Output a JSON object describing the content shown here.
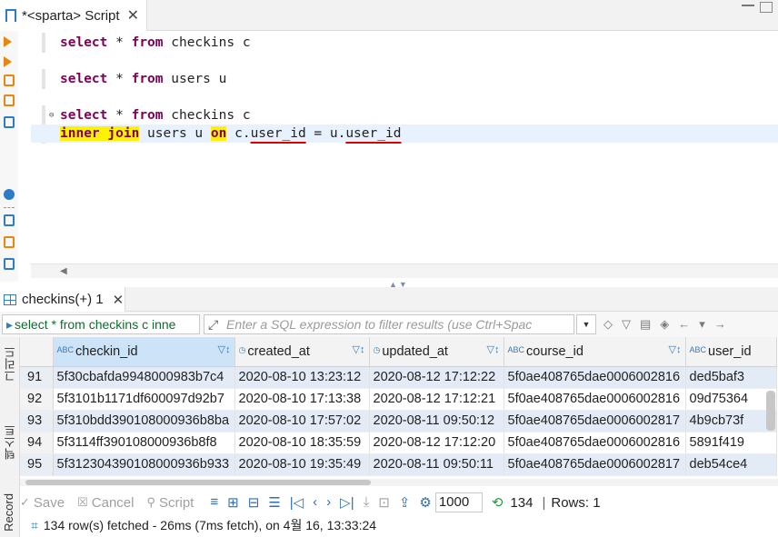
{
  "editor_tab": {
    "title": "*<sparta> Script",
    "close": "✕"
  },
  "editor": {
    "line1": {
      "kw1": "select",
      "mid": " * ",
      "kw2": "from",
      "rest": " checkins c"
    },
    "line2": {
      "kw1": "select",
      "mid": " * ",
      "kw2": "from",
      "rest": " users u"
    },
    "line3": {
      "kw1": "select",
      "mid": " * ",
      "kw2": "from",
      "rest": " checkins c"
    },
    "line4": {
      "join": "inner join",
      "mid": " users u ",
      "on": "on",
      "c": " c.",
      "cfield": "user_id",
      "eq": " = u.",
      "ufield": "user_id"
    }
  },
  "result_tab": {
    "title": "checkins(+) 1",
    "close": "✕"
  },
  "filter": {
    "query_text": "select * from checkins c inne",
    "placeholder": "Enter a SQL expression to filter results (use Ctrl+Spac"
  },
  "vertical_tabs": {
    "grid": "그리드",
    "text": "텍스트",
    "record": "Record"
  },
  "grid": {
    "columns": [
      "checkin_id",
      "created_at",
      "updated_at",
      "course_id",
      "user_id"
    ],
    "rows": [
      {
        "n": "91",
        "checkin_id": "5f30cbafda9948000983b7c4",
        "created_at": "2020-08-10 13:23:12",
        "updated_at": "2020-08-12 17:12:22",
        "course_id": "5f0ae408765dae0006002816",
        "user_id": "ded5baf3"
      },
      {
        "n": "92",
        "checkin_id": "5f3101b1171df600097d92b7",
        "created_at": "2020-08-10 17:13:38",
        "updated_at": "2020-08-12 17:12:21",
        "course_id": "5f0ae408765dae0006002816",
        "user_id": "09d75364"
      },
      {
        "n": "93",
        "checkin_id": "5f310bdd390108000936b8ba",
        "created_at": "2020-08-10 17:57:02",
        "updated_at": "2020-08-11 09:50:12",
        "course_id": "5f0ae408765dae0006002817",
        "user_id": "4b9cb73f"
      },
      {
        "n": "94",
        "checkin_id": "5f3114ff390108000936b8f8",
        "created_at": "2020-08-10 18:35:59",
        "updated_at": "2020-08-12 17:12:20",
        "course_id": "5f0ae408765dae0006002816",
        "user_id": "5891f419"
      },
      {
        "n": "95",
        "checkin_id": "5f312304390108000936b933",
        "created_at": "2020-08-10 19:35:49",
        "updated_at": "2020-08-11 09:50:11",
        "course_id": "5f0ae408765dae0006002817",
        "user_id": "deb54ce4"
      }
    ]
  },
  "bottom": {
    "save": "Save",
    "cancel": "Cancel",
    "script": "Script",
    "limit_value": "1000",
    "fetched_count": "134",
    "rows_label": "Rows: 1"
  },
  "status": {
    "text": "134 row(s) fetched - 26ms (7ms fetch), on 4월 16, 13:33:24"
  },
  "colors": {
    "keyword": "#7f0055",
    "highlight": "#fff200",
    "underline": "#e00000",
    "selected_header": "#cde3f7",
    "alt_row": "#e3ebf6",
    "accent": "#2f7cc6"
  }
}
